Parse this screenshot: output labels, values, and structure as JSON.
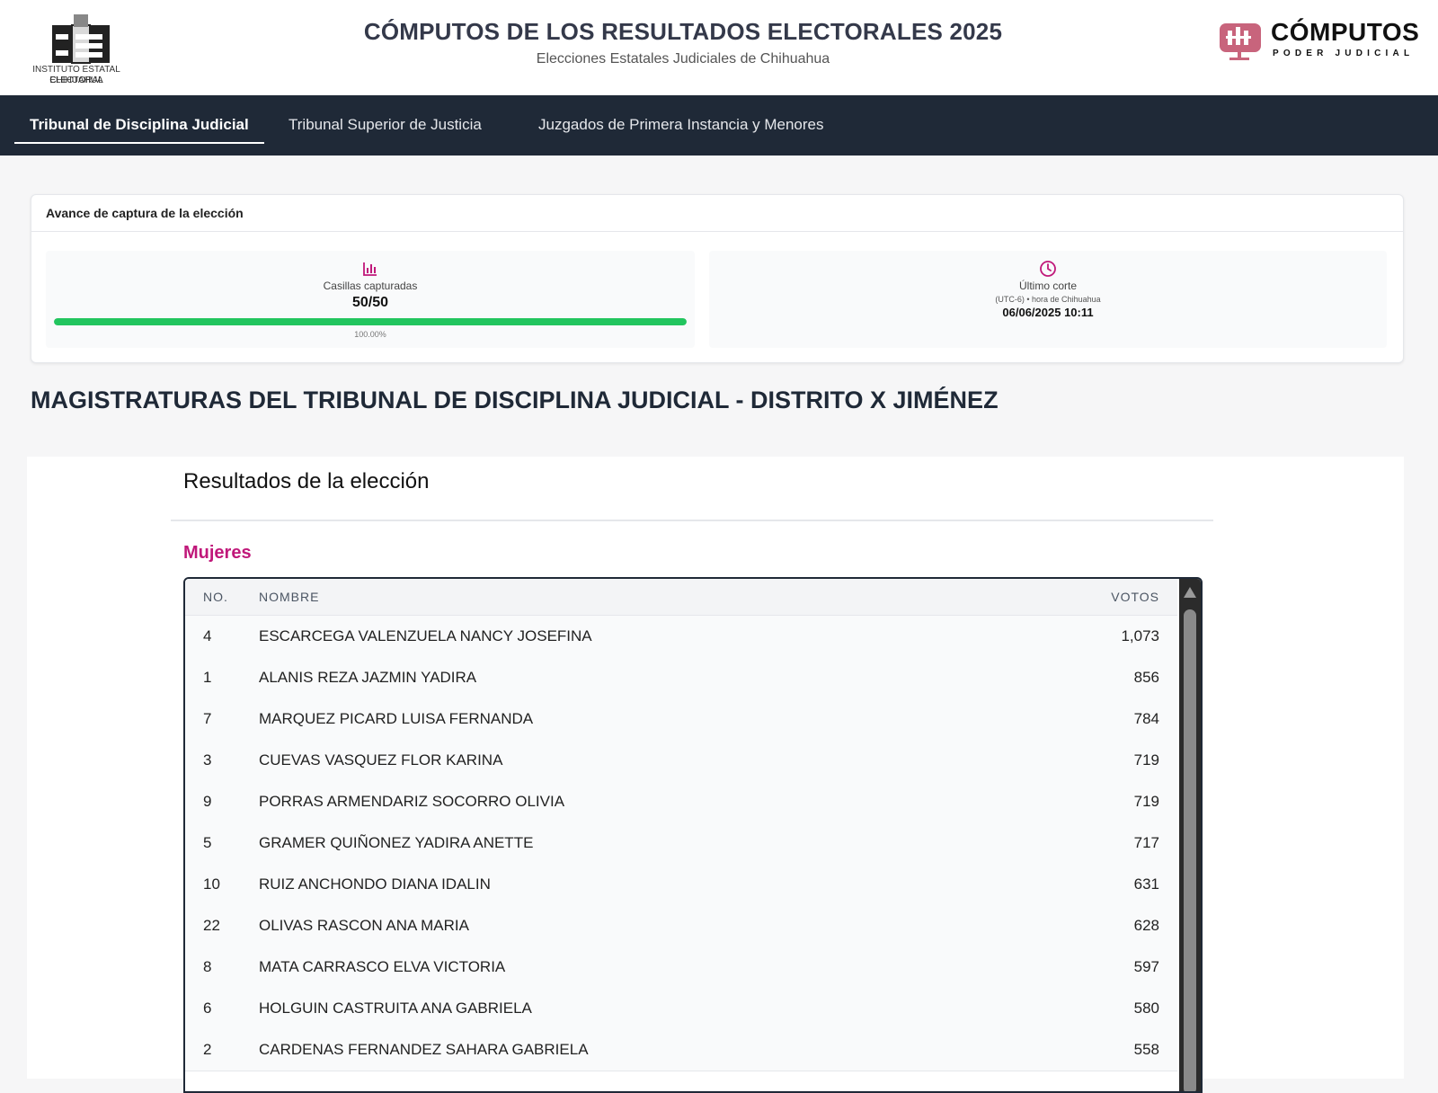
{
  "header": {
    "org_caption_line1": "INSTITUTO ESTATAL ELECTORAL",
    "org_caption_line2": "CHIHUAHUA",
    "title": "CÓMPUTOS DE LOS RESULTADOS ELECTORALES 2025",
    "subtitle": "Elecciones Estatales Judiciales de Chihuahua",
    "brand_word": "CÓMPUTOS",
    "brand_sub": "PODER JUDICIAL"
  },
  "nav": {
    "tabs": [
      {
        "label": "Tribunal de Disciplina Judicial",
        "active": true
      },
      {
        "label": "Tribunal Superior de Justicia",
        "active": false
      },
      {
        "label": "Juzgados de Primera Instancia y Menores",
        "active": false
      }
    ]
  },
  "progress": {
    "heading": "Avance de captura de la elección",
    "captured_label": "Casillas capturadas",
    "captured_value": "50/50",
    "percent_text": "100.00%",
    "fill_fraction": 1.0,
    "cut_label": "Último corte",
    "cut_timezone": "(UTC-6) • hora de Chihuahua",
    "cut_value": "06/06/2025 10:11"
  },
  "section": {
    "title": "MAGISTRATURAS DEL TRIBUNAL DE DISCIPLINA JUDICIAL - DISTRITO X JIMÉNEZ"
  },
  "results": {
    "title": "Resultados de la elección",
    "group": "Mujeres",
    "columns": {
      "no": "NO.",
      "name": "NOMBRE",
      "votes": "VOTOS"
    },
    "rows": [
      {
        "no": "4",
        "name": "ESCARCEGA VALENZUELA NANCY JOSEFINA",
        "votes": "1,073"
      },
      {
        "no": "1",
        "name": "ALANIS REZA JAZMIN YADIRA",
        "votes": "856"
      },
      {
        "no": "7",
        "name": "MARQUEZ PICARD LUISA FERNANDA",
        "votes": "784"
      },
      {
        "no": "3",
        "name": "CUEVAS VASQUEZ FLOR KARINA",
        "votes": "719"
      },
      {
        "no": "9",
        "name": "PORRAS ARMENDARIZ SOCORRO OLIVIA",
        "votes": "719"
      },
      {
        "no": "5",
        "name": "GRAMER QUIÑONEZ YADIRA ANETTE",
        "votes": "717"
      },
      {
        "no": "10",
        "name": "RUIZ ANCHONDO DIANA IDALIN",
        "votes": "631"
      },
      {
        "no": "22",
        "name": "OLIVAS RASCON ANA MARIA",
        "votes": "628"
      },
      {
        "no": "8",
        "name": "MATA CARRASCO ELVA VICTORIA",
        "votes": "597"
      },
      {
        "no": "6",
        "name": "HOLGUIN CASTRUITA ANA GABRIELA",
        "votes": "580"
      },
      {
        "no": "2",
        "name": "CARDENAS FERNANDEZ SAHARA GABRIELA",
        "votes": "558"
      }
    ]
  },
  "colors": {
    "accent": "#c0187a",
    "nav_bg": "#1f2937",
    "progress": "#22c55e"
  },
  "icons": {
    "captured": "bar-chart-icon",
    "cut": "clock-icon",
    "scroll_up": "triangle-up-icon"
  }
}
